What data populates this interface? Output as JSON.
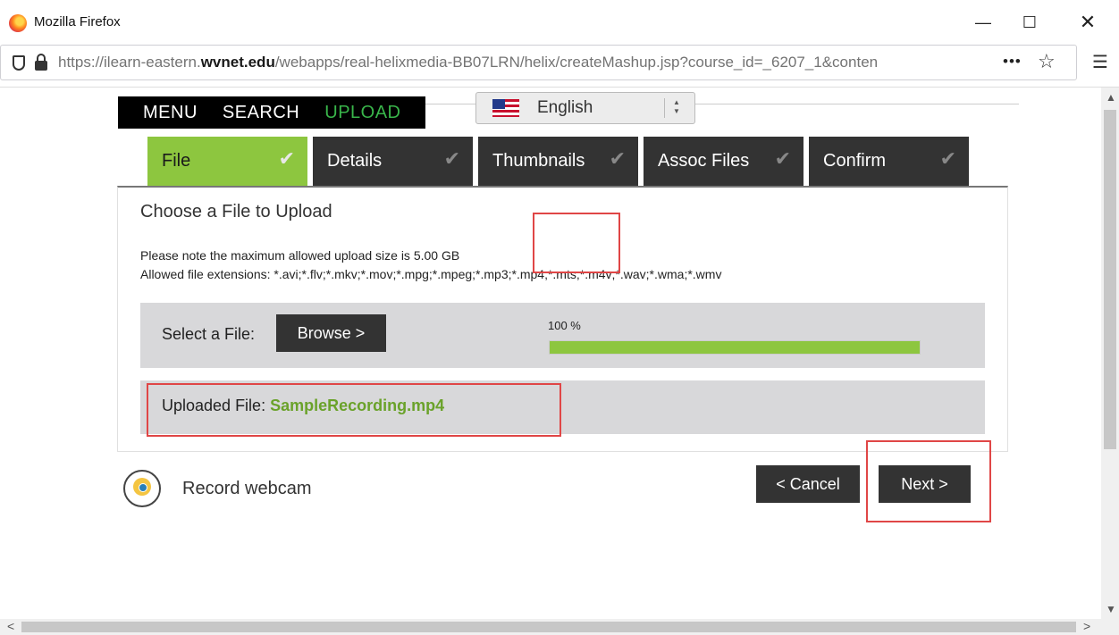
{
  "window": {
    "title": "Mozilla Firefox",
    "minimize_glyph": "—",
    "maximize_glyph": "☐",
    "close_glyph": "✕"
  },
  "address_bar": {
    "url_prefix": "https://ilearn-eastern.",
    "url_domain": "wvnet.edu",
    "url_rest": "/webapps/real-helixmedia-BB07LRN/helix/createMashup.jsp?course_id=_6207_1&conten",
    "more_glyph": "•••",
    "star_glyph": "☆",
    "menu_glyph": "☰"
  },
  "topnav": {
    "items": [
      {
        "label": "MENU",
        "color": "#ffffff"
      },
      {
        "label": "SEARCH",
        "color": "#ffffff"
      },
      {
        "label": "UPLOAD",
        "color": "#39b54a"
      }
    ]
  },
  "language": {
    "selected": "English",
    "arrow_up": "▲",
    "arrow_down": "▼"
  },
  "tabs": [
    {
      "label": "File",
      "active": true
    },
    {
      "label": "Details",
      "active": false
    },
    {
      "label": "Thumbnails",
      "active": false
    },
    {
      "label": "Assoc Files",
      "active": false
    },
    {
      "label": "Confirm",
      "active": false
    }
  ],
  "check_glyph": "✔",
  "panel": {
    "title": "Choose a File to Upload",
    "note_line1": "Please note the maximum allowed upload size is 5.00 GB",
    "note_line2": "Allowed file extensions: *.avi;*.flv;*.mkv;*.mov;*.mpg;*.mpeg;*.mp3;*.mp4;*.mts;*.m4v;*.wav;*.wma;*.wmv",
    "select_label": "Select a File:",
    "browse_label": "Browse >",
    "progress_text": "100 %",
    "progress_fraction": 1.0,
    "uploaded_label": "Uploaded File:",
    "uploaded_filename": "SampleRecording.mp4"
  },
  "webcam": {
    "label": "Record webcam"
  },
  "actions": {
    "cancel_label": "< Cancel",
    "next_label": "Next >"
  },
  "scrollbars": {
    "up_glyph": "▲",
    "down_glyph": "▼",
    "left_glyph": "<",
    "right_glyph": ">"
  },
  "colors": {
    "accent_green": "#8dc63f",
    "filename_green": "#6aa22a",
    "highlight_red": "#e04646",
    "button_dark": "#333333"
  }
}
